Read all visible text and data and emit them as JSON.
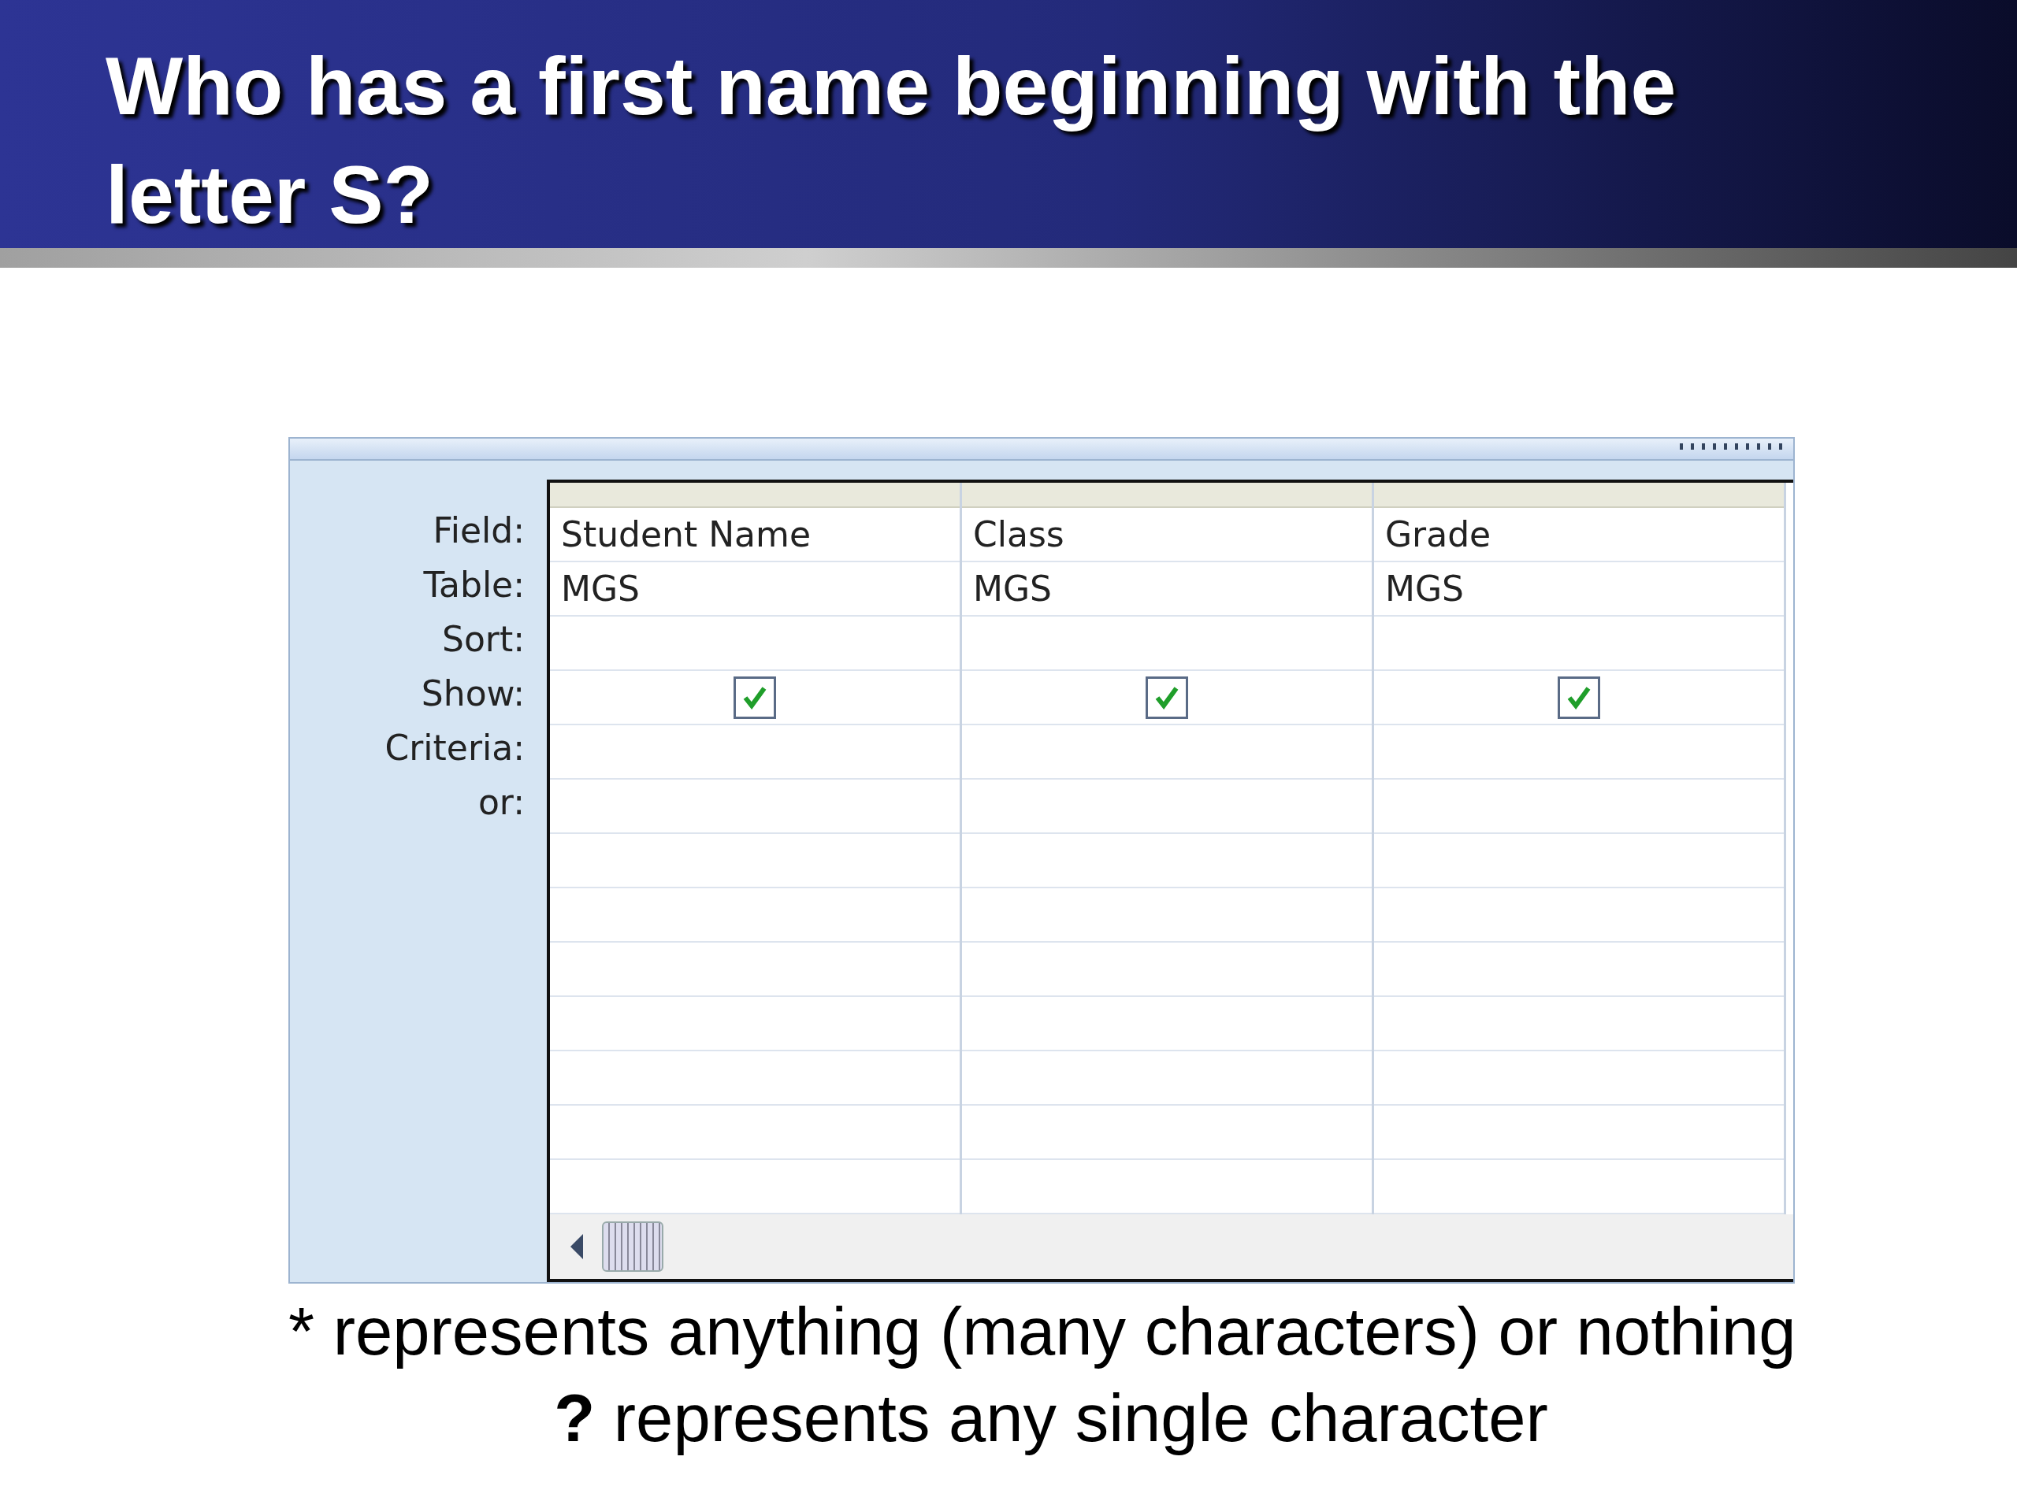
{
  "slide": {
    "title": "Who has a first name beginning with the letter S?"
  },
  "query_grid": {
    "row_labels": [
      "Field:",
      "Table:",
      "Sort:",
      "Show:",
      "Criteria:",
      "or:"
    ],
    "columns": [
      {
        "field": "Student Name",
        "table": "MGS",
        "show": true
      },
      {
        "field": "Class",
        "table": "MGS",
        "show": true
      },
      {
        "field": "Grade",
        "table": "MGS",
        "show": true
      }
    ]
  },
  "notes": [
    "* represents anything (many characters) or nothing",
    "**?** represents any single character"
  ]
}
